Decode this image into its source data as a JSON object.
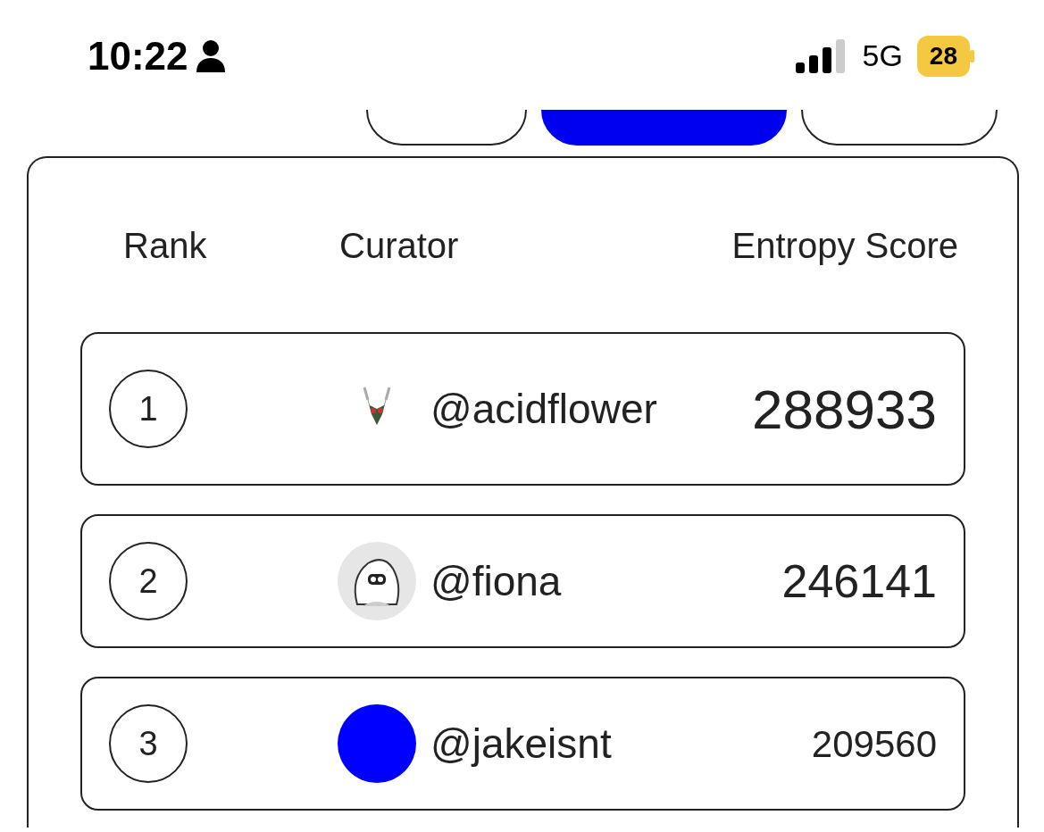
{
  "status_bar": {
    "time": "10:22",
    "network": "5G",
    "battery": "28"
  },
  "tabs": [
    {
      "selected": false
    },
    {
      "selected": true
    },
    {
      "selected": false
    }
  ],
  "table": {
    "columns": [
      "Rank",
      "Curator",
      "Entropy Score"
    ],
    "rows": [
      {
        "rank": "1",
        "handle": "@acidflower",
        "score": "288933",
        "kind": "large"
      },
      {
        "rank": "2",
        "handle": "@fiona",
        "score": "246141",
        "kind": "medium"
      },
      {
        "rank": "3",
        "avatar": {
          "kind": "color",
          "color": "#0000ff"
        },
        "handle": "@jakeisnt",
        "score": "209560",
        "kind": "small"
      }
    ]
  }
}
